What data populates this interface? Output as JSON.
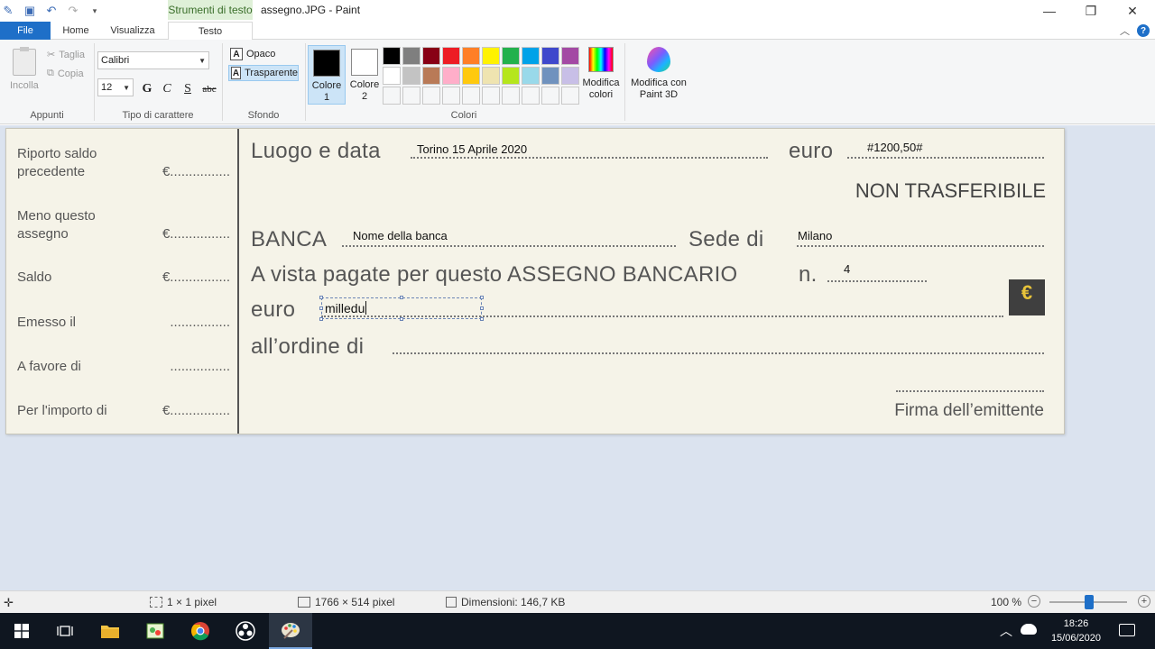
{
  "window": {
    "title": "assegno.JPG - Paint",
    "context_tab_label": "Strumenti di testo"
  },
  "tabs": {
    "file": "File",
    "home": "Home",
    "view": "Visualizza",
    "text": "Testo"
  },
  "ribbon": {
    "clipboard": {
      "label": "Appunti",
      "paste": "Incolla",
      "cut": "Taglia",
      "copy": "Copia"
    },
    "font": {
      "label": "Tipo di carattere",
      "family": "Calibri",
      "size": "12",
      "bold": "G",
      "italic": "C",
      "underline": "S",
      "strike": "abc"
    },
    "background": {
      "label": "Sfondo",
      "opaque": "Opaco",
      "transparent": "Trasparente",
      "selected": "Trasparente"
    },
    "colors": {
      "label": "Colori",
      "color1_label": "Colore\n1",
      "color1_line1": "Colore",
      "color1_line2": "1",
      "color1_value": "#000000",
      "color2_line1": "Colore",
      "color2_line2": "2",
      "color2_value": "#ffffff",
      "edit_line1": "Modifica",
      "edit_line2": "colori",
      "paint3d_line1": "Modifica con",
      "paint3d_line2": "Paint 3D",
      "palette": [
        "#000000",
        "#7f7f7f",
        "#880015",
        "#ed1c24",
        "#ff7f27",
        "#fff200",
        "#22b14c",
        "#00a2e8",
        "#3f48cc",
        "#a349a4",
        "#ffffff",
        "#c3c3c3",
        "#b97a57",
        "#ffaec9",
        "#ffc90e",
        "#efe4b0",
        "#b5e61d",
        "#99d9ea",
        "#7092be",
        "#c8bfe7",
        "#f5f6f7",
        "#f5f6f7",
        "#f5f6f7",
        "#f5f6f7",
        "#f5f6f7",
        "#f5f6f7",
        "#f5f6f7",
        "#f5f6f7",
        "#f5f6f7",
        "#f5f6f7"
      ]
    }
  },
  "cheque": {
    "stub": [
      {
        "label": "Riporto saldo precedente",
        "dots": "€................"
      },
      {
        "label": "Meno questo assegno",
        "dots": "€................"
      },
      {
        "label": "Saldo",
        "dots": "€................"
      },
      {
        "label": "Emesso il",
        "dots": "................"
      },
      {
        "label": "A favore di",
        "dots": "................"
      },
      {
        "label": "Per  l'importo di",
        "dots": "€................"
      }
    ],
    "place_date_label": "Luogo e data",
    "place_date_value": "Torino 15 Aprile 2020",
    "euro_label": "euro",
    "amount_numeric": "#1200,50#",
    "non_transferable": "NON TRASFERIBILE",
    "bank_label": "BANCA",
    "bank_value": "Nome della banca",
    "branch_label": "Sede di",
    "branch_value": "Milano",
    "pay_line": "A vista pagate per questo ASSEGNO BANCARIO",
    "number_label": "n.",
    "number_value": "4",
    "amount_words_label": "euro",
    "amount_words_value": "milledu",
    "order_label": "all’ordine di",
    "signature_label": "Firma dell’emittente",
    "euro_badge": "€"
  },
  "status": {
    "position": "",
    "selection": "1 × 1 pixel",
    "image_size": "1766 × 514 pixel",
    "file_size": "Dimensioni: 146,7 KB",
    "zoom": "100 %"
  },
  "taskbar": {
    "time": "18:26",
    "date": "15/06/2020"
  }
}
